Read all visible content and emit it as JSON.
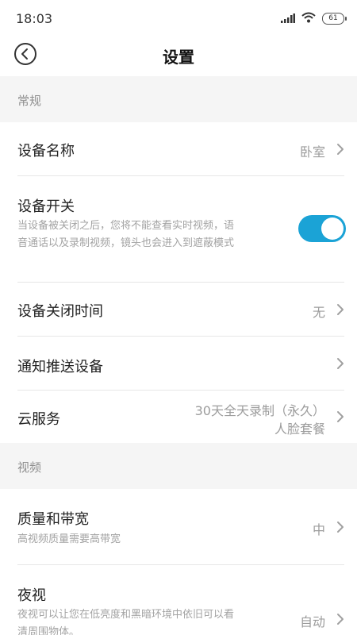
{
  "status_bar": {
    "time": "18:03",
    "battery": "61",
    "icons": [
      "signal-icon",
      "wifi-icon",
      "battery-icon"
    ]
  },
  "nav": {
    "title": "设置",
    "back_icon": "back-icon"
  },
  "sections": {
    "general": "常规",
    "video": "视频"
  },
  "rows": {
    "device_name": {
      "title": "设备名称",
      "value": "卧室"
    },
    "device_switch": {
      "title": "设备开关",
      "sub_line1": "当设备被关闭之后，您将不能查看实时视频，语",
      "sub_line2": "音通话以及录制视频，镜头也会进入到遮蔽模式",
      "enabled": true
    },
    "shutdown_time": {
      "title": "设备关闭时间",
      "value": "无"
    },
    "notify_push": {
      "title": "通知推送设备"
    },
    "cloud_service": {
      "title": "云服务",
      "value_line1": "30天全天录制（永久）",
      "value_line2": "人脸套餐"
    },
    "quality": {
      "title": "质量和带宽",
      "sub": "高视频质量需要高带宽",
      "value": "中"
    },
    "night_vision": {
      "title": "夜视",
      "sub_line1": "夜视可以让您在低亮度和黑暗环境中依旧可以看",
      "sub_line2": "清周围物体。",
      "value": "自动"
    }
  },
  "colors": {
    "accent": "#1ba3d6",
    "section_bg": "#f5f5f5",
    "secondary_text": "#9c9c9c"
  }
}
